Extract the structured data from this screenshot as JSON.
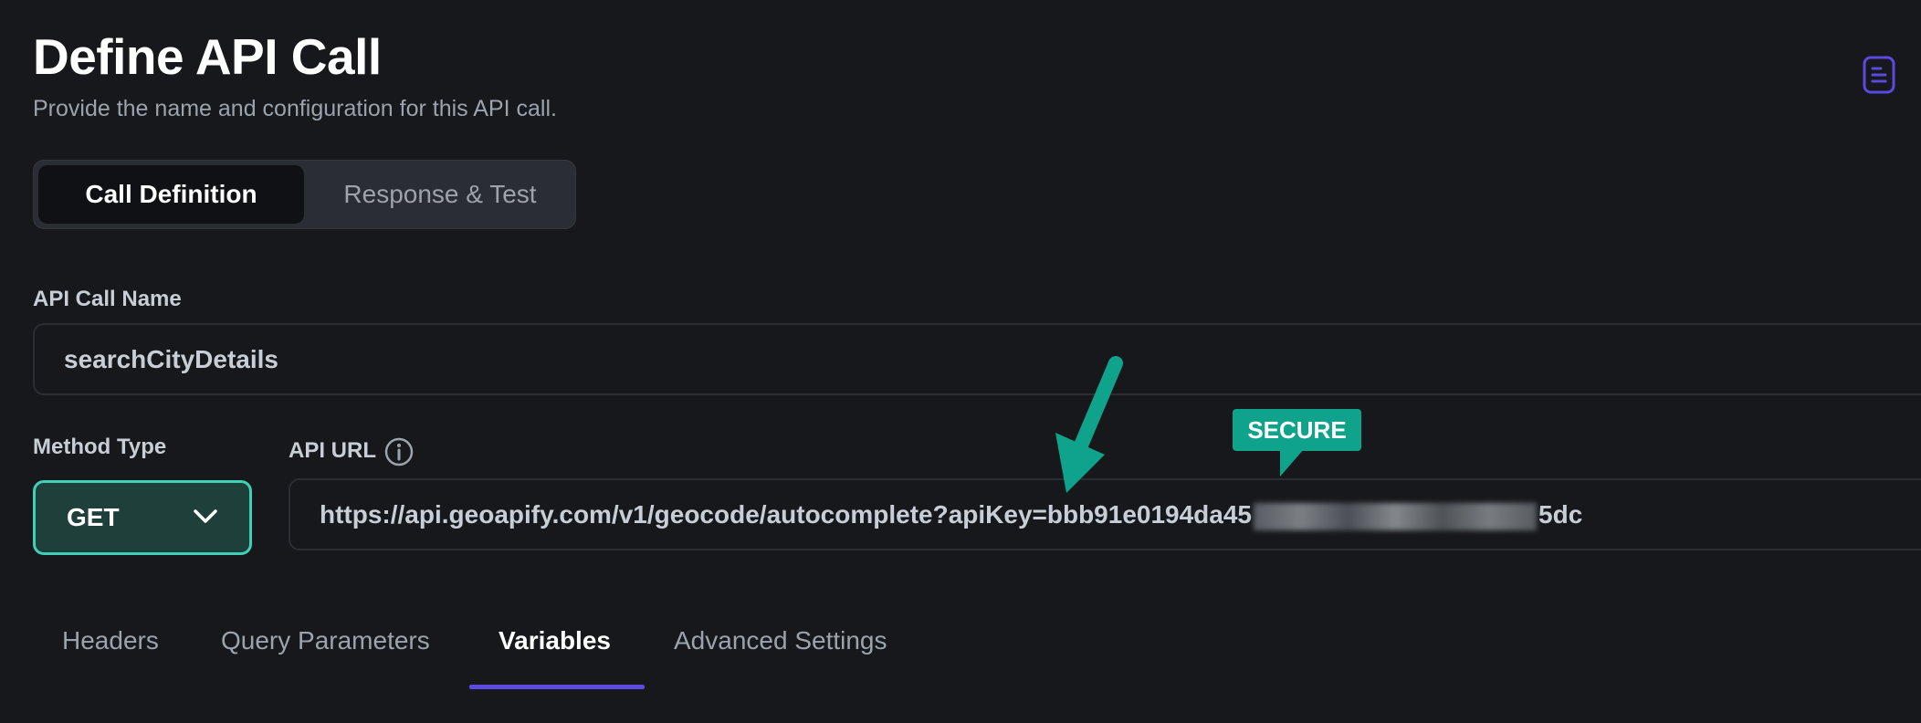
{
  "page": {
    "title": "Define API Call",
    "subtitle": "Provide the name and configuration for this API call."
  },
  "segment_tabs": [
    {
      "label": "Call Definition",
      "active": true
    },
    {
      "label": "Response & Test",
      "active": false
    }
  ],
  "api_call_name": {
    "label": "API Call Name",
    "value": "searchCityDetails"
  },
  "method_type": {
    "label": "Method Type",
    "selected": "GET"
  },
  "api_url": {
    "label": "API URL",
    "value_visible_start": "https://api.geoapify.com/v1/geocode/autocomplete?apiKey=bbb91e0194da45",
    "value_visible_end": "5dc"
  },
  "annotation": {
    "badge_text": "SECURE",
    "color": "#10a38b"
  },
  "bottom_tabs": [
    {
      "label": "Headers",
      "active": false
    },
    {
      "label": "Query Parameters",
      "active": false
    },
    {
      "label": "Variables",
      "active": true
    },
    {
      "label": "Advanced Settings",
      "active": false
    }
  ],
  "icons": {
    "header_right": "document-icon",
    "info": "info-icon",
    "dropdown": "chevron-down-icon"
  },
  "colors": {
    "background": "#16181b",
    "accent_teal": "#3fd0b5",
    "accent_purple": "#5b49e0"
  }
}
